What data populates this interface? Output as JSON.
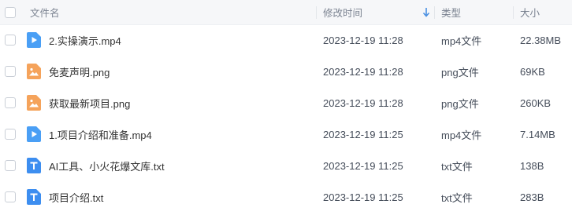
{
  "header": {
    "name_label": "文件名",
    "time_label": "修改时间",
    "type_label": "类型",
    "size_label": "大小"
  },
  "colors": {
    "video_icon": "#4a9ff5",
    "image_icon": "#f5a35b",
    "text_icon": "#3d8ef0",
    "sort_arrow": "#4a90e2"
  },
  "files": [
    {
      "name": "2.实操演示.mp4",
      "modified": "2023-12-19 11:28",
      "type": "mp4文件",
      "size": "22.38MB",
      "icon": "video-file-icon"
    },
    {
      "name": "免麦声明.png",
      "modified": "2023-12-19 11:28",
      "type": "png文件",
      "size": "69KB",
      "icon": "image-file-icon"
    },
    {
      "name": "获取最新项目.png",
      "modified": "2023-12-19 11:28",
      "type": "png文件",
      "size": "260KB",
      "icon": "image-file-icon"
    },
    {
      "name": "1.项目介绍和准备.mp4",
      "modified": "2023-12-19 11:25",
      "type": "mp4文件",
      "size": "7.14MB",
      "icon": "video-file-icon"
    },
    {
      "name": "AI工具、小火花爆文库.txt",
      "modified": "2023-12-19 11:25",
      "type": "txt文件",
      "size": "138B",
      "icon": "text-file-icon"
    },
    {
      "name": "项目介绍.txt",
      "modified": "2023-12-19 11:25",
      "type": "txt文件",
      "size": "283B",
      "icon": "text-file-icon"
    }
  ]
}
